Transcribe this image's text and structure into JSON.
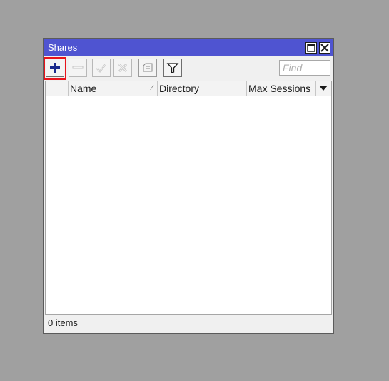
{
  "window": {
    "title": "Shares"
  },
  "toolbar": {
    "buttons": [
      {
        "name": "add",
        "icon": "plus-icon"
      },
      {
        "name": "remove",
        "icon": "minus-icon"
      },
      {
        "name": "enable",
        "icon": "check-icon"
      },
      {
        "name": "disable",
        "icon": "x-icon"
      },
      {
        "name": "comment",
        "icon": "comment-icon"
      },
      {
        "name": "filter",
        "icon": "filter-icon"
      }
    ],
    "find_placeholder": "Find"
  },
  "table": {
    "columns": [
      "Name",
      "Directory",
      "Max Sessions"
    ],
    "rows": []
  },
  "status": {
    "items_text": "0 items"
  },
  "colors": {
    "titlebar": "#4f54d1",
    "highlight": "#e8131b",
    "add_icon": "#1b2a8c"
  }
}
